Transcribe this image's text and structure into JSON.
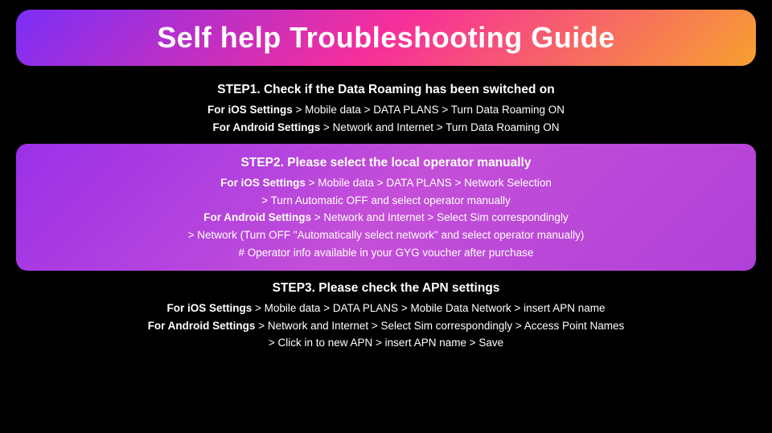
{
  "title": "Self help Troubleshooting Guide",
  "steps": [
    {
      "id": "step1",
      "highlighted": false,
      "title": "STEP1. Check if the Data Roaming has been switched on",
      "lines": [
        {
          "bold": "For iOS Settings",
          "rest": " > Mobile data > DATA PLANS > Turn Data Roaming ON"
        },
        {
          "bold": "For Android Settings",
          "rest": " > Network and Internet > Turn Data Roaming ON"
        }
      ]
    },
    {
      "id": "step2",
      "highlighted": true,
      "title": "STEP2. Please select the local operator manually",
      "lines": [
        {
          "bold": "For iOS Settings",
          "rest": " > Mobile data > DATA PLANS > Network Selection"
        },
        {
          "bold": "",
          "rest": "> Turn Automatic OFF and select operator manually"
        },
        {
          "bold": "For Android Settings",
          "rest": " > Network and Internet > Select Sim correspondingly"
        },
        {
          "bold": "",
          "rest": "> Network (Turn OFF \"Automatically select network\" and select operator manually)"
        },
        {
          "bold": "",
          "rest": "# Operator info available in your GYG voucher after purchase"
        }
      ]
    },
    {
      "id": "step3",
      "highlighted": false,
      "title": "STEP3. Please check the APN settings",
      "lines": [
        {
          "bold": "For iOS Settings",
          "rest": " > Mobile data > DATA PLANS > Mobile Data Network > insert APN name"
        },
        {
          "bold": "For Android Settings",
          "rest": " > Network and Internet > Select Sim correspondingly > Access Point Names"
        },
        {
          "bold": "",
          "rest": "> Click in to new APN > insert APN name > Save"
        }
      ]
    }
  ]
}
